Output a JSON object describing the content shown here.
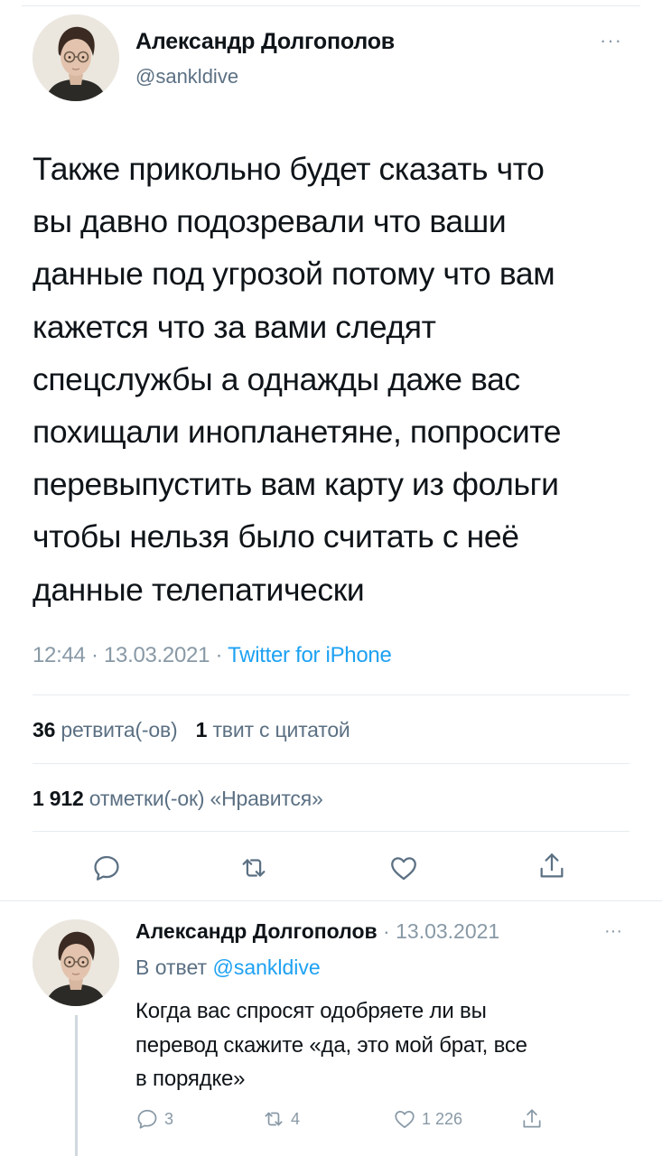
{
  "tweet": {
    "author_name": "Александр Долгополов",
    "author_handle": "@sankldive",
    "text": "Также прикольно будет сказать что\nвы давно подозревали что ваши\nданные под угрозой потому что вам\nкажется что за вами следят\nспецслужбы а однажды даже вас\nпохищали инопланетяне, попросите\nперевыпустить вам карту из фольги\nчтобы нельзя было считать с неё\nданные телепатически",
    "time": "12:44",
    "date": "13.03.2021",
    "source": "Twitter for iPhone",
    "retweets_count": "36",
    "retweets_label": "ретвита(-ов)",
    "quotes_count": "1",
    "quotes_label": "твит с цитатой",
    "likes_count": "1 912",
    "likes_label": "отметки(-ок) «Нравится»",
    "more_icon": "more-icon",
    "actions": [
      "reply-icon",
      "retweet-icon",
      "like-icon",
      "share-icon"
    ]
  },
  "reply": {
    "author_name": "Александр Долгополов",
    "date": "13.03.2021",
    "reply_to_label": "В ответ",
    "reply_to_handle": "@sankldive",
    "text": "Когда вас спросят одобряете ли вы\nперевод скажите «да, это мой брат, все\nв порядке»",
    "reply_count": "3",
    "retweet_count": "4",
    "like_count": "1 226"
  },
  "colors": {
    "accent": "#1da1f2",
    "secondary_text": "#5b7083",
    "muted": "#8899a6",
    "divider": "#e6ecf0"
  }
}
